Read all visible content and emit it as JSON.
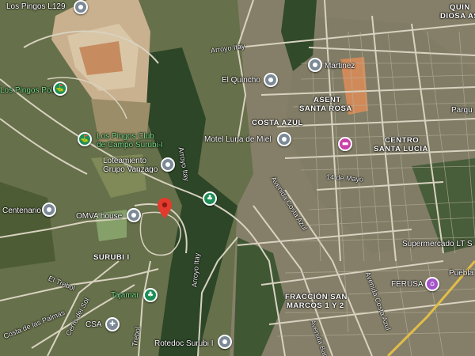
{
  "map": {
    "places": [
      {
        "name": "Los Pingos L129"
      },
      {
        "name": "Los Pingos Polo"
      },
      {
        "name": "Los Pingos Club de Campo Surubi-I"
      },
      {
        "name": "Loteamiento Grupo Vanzago"
      },
      {
        "name": "El Quincho"
      },
      {
        "name": "Martinez"
      },
      {
        "name": "Motel Luna de Miel"
      },
      {
        "name": "Centenario"
      },
      {
        "name": "OMVA house"
      },
      {
        "name": "Tajamar"
      },
      {
        "name": "CSA"
      },
      {
        "name": "Rotedoc Surubi I"
      },
      {
        "name": "Supermercado LT S..."
      },
      {
        "name": "FERUSA"
      }
    ],
    "labels": {
      "los_pingos_l129": "Los Pingos L129",
      "los_pingos_polo": "Los Pingos Polo",
      "club_line1": "Los Pingos Club",
      "club_line2": "de Campo Surubi-I",
      "vanzago_line1": "Loteamiento",
      "vanzago_line2": "Grupo Vanzago",
      "el_quincho": "El Quincho",
      "martinez": "Martinez",
      "motel": "Motel Luna de Miel",
      "centenario": "Centenario",
      "omva": "OMVA house",
      "tajamar": "Tajamar",
      "csa": "CSA",
      "rotedoc": "Rotedoc Surubi I",
      "supermercado": "Supermercado LT S",
      "ferusa": "FERUSA",
      "quin_line1": "QUIN",
      "quin_line2": "DIOSA AS",
      "asent_line1": "ASENT",
      "asent_line2": "SANTA ROSA",
      "costa_azul": "COSTA AZUL",
      "centro_line1": "CENTRO",
      "centro_line2": "SANTA LUCIA",
      "surubi": "SURUBI I",
      "fraccion_line1": "FRACCIÓN SAN",
      "fraccion_line2": "MARCOS 1 Y 2",
      "puebla": "Puebla",
      "parque": "Parqu"
    },
    "streets": {
      "arroyo_itay_top": "Arroyo Itay",
      "arroyo_itay_mid": "Arroyo Itay",
      "arroyo_itay_low": "Arroyo Itay",
      "avenida_costa_azul": "Avenida Costa Azul",
      "avenida_costa_azul_2": "Avenida Costa Azul",
      "catorce_de_mayo": "14 de Mayo",
      "el_trebol": "El Trebol",
      "cerro_del_sol": "Cerro del Sol",
      "costa_de_las_palmas": "Costa de las Palmas",
      "trebol_vert": "Trebol",
      "avenida_bar": "Avenida Bar"
    },
    "colors": {
      "vegetation": "#5f6a3e",
      "forest": "#2f4a2a",
      "urban": "#8a8470",
      "road": "#d9d4c4",
      "highway": "#e8c04a",
      "red_pin": "#e23b2e"
    }
  }
}
